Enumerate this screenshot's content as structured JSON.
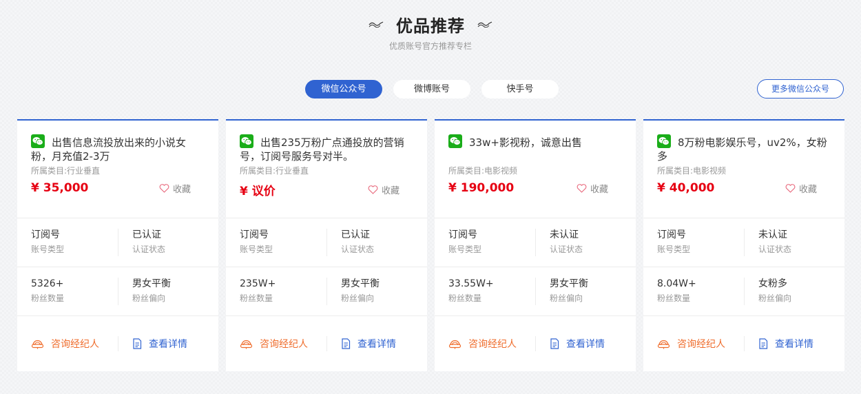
{
  "header": {
    "title": "优品推荐",
    "subtitle": "优质账号官方推荐专栏"
  },
  "tabs": [
    {
      "label": "微信公众号",
      "active": true
    },
    {
      "label": "微博账号",
      "active": false
    },
    {
      "label": "快手号",
      "active": false
    }
  ],
  "more_button": "更多微信公众号",
  "cards": [
    {
      "title": "出售信息流投放出来的小说女粉，月充值2-3万",
      "category": "所属类目:行业垂直",
      "price": "¥ 35,000",
      "fav_label": "收藏",
      "account_type": "订阅号",
      "account_type_label": "账号类型",
      "auth_status": "已认证",
      "auth_status_label": "认证状态",
      "fans": "5326+",
      "fans_label": "粉丝数量",
      "gender": "男女平衡",
      "gender_label": "粉丝偏向",
      "consult_label": "咨询经纪人",
      "detail_label": "查看详情"
    },
    {
      "title": "出售235万粉广点通投放的营销号，订阅号服务号对半。",
      "category": "所属类目:行业垂直",
      "price": "¥ 议价",
      "fav_label": "收藏",
      "account_type": "订阅号",
      "account_type_label": "账号类型",
      "auth_status": "已认证",
      "auth_status_label": "认证状态",
      "fans": "235W+",
      "fans_label": "粉丝数量",
      "gender": "男女平衡",
      "gender_label": "粉丝偏向",
      "consult_label": "咨询经纪人",
      "detail_label": "查看详情"
    },
    {
      "title": "33w+影视粉，诚意出售",
      "category": "所属类目:电影视频",
      "price": "¥ 190,000",
      "fav_label": "收藏",
      "account_type": "订阅号",
      "account_type_label": "账号类型",
      "auth_status": "未认证",
      "auth_status_label": "认证状态",
      "fans": "33.55W+",
      "fans_label": "粉丝数量",
      "gender": "男女平衡",
      "gender_label": "粉丝偏向",
      "consult_label": "咨询经纪人",
      "detail_label": "查看详情"
    },
    {
      "title": "8万粉电影娱乐号，uv2%，女粉多",
      "category": "所属类目:电影视频",
      "price": "¥ 40,000",
      "fav_label": "收藏",
      "account_type": "订阅号",
      "account_type_label": "账号类型",
      "auth_status": "未认证",
      "auth_status_label": "认证状态",
      "fans": "8.04W+",
      "fans_label": "粉丝数量",
      "gender": "女粉多",
      "gender_label": "粉丝偏向",
      "consult_label": "咨询经纪人",
      "detail_label": "查看详情"
    }
  ],
  "icons": {
    "platform": "wechat-icon",
    "favorite": "heart-outline-icon",
    "consult": "agent-icon",
    "detail": "document-icon",
    "title_decoration": "wave-icon"
  },
  "colors": {
    "primary": "#3063d1",
    "price": "#e60012",
    "consult": "#ef6d2d",
    "wechat": "#1aad19"
  }
}
